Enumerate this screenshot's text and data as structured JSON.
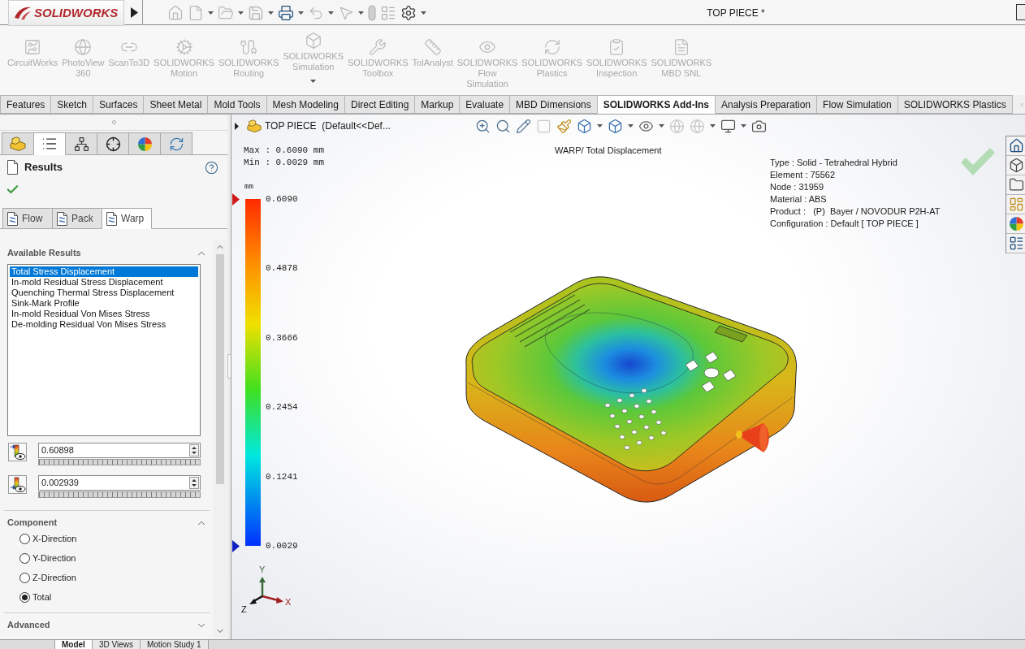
{
  "title_bar": {
    "brand": "SOLIDWORKS",
    "document_title": "TOP PIECE *"
  },
  "command_manager": {
    "items": [
      {
        "label_lines": [
          "CircuitWorks"
        ],
        "dropdown": false
      },
      {
        "label_lines": [
          "PhotoView",
          "360"
        ],
        "dropdown": false
      },
      {
        "label_lines": [
          "ScanTo3D"
        ],
        "dropdown": false
      },
      {
        "label_lines": [
          "SOLIDWORKS",
          "Motion"
        ],
        "dropdown": false
      },
      {
        "label_lines": [
          "SOLIDWORKS",
          "Routing"
        ],
        "dropdown": false
      },
      {
        "label_lines": [
          "SOLIDWORKS",
          "Simulation"
        ],
        "dropdown": true
      },
      {
        "label_lines": [
          "SOLIDWORKS",
          "Toolbox"
        ],
        "dropdown": false
      },
      {
        "label_lines": [
          "TolAnalyst"
        ],
        "dropdown": false
      },
      {
        "label_lines": [
          "SOLIDWORKS",
          "Flow",
          "Simulation"
        ],
        "dropdown": false
      },
      {
        "label_lines": [
          "SOLIDWORKS",
          "Plastics"
        ],
        "dropdown": false
      },
      {
        "label_lines": [
          "SOLIDWORKS",
          "Inspection"
        ],
        "dropdown": false
      },
      {
        "label_lines": [
          "SOLIDWORKS",
          "MBD SNL"
        ],
        "dropdown": false
      }
    ]
  },
  "tabs": [
    {
      "label": "Features",
      "selected": false
    },
    {
      "label": "Sketch",
      "selected": false
    },
    {
      "label": "Surfaces",
      "selected": false
    },
    {
      "label": "Sheet Metal",
      "selected": false
    },
    {
      "label": "Mold Tools",
      "selected": false
    },
    {
      "label": "Mesh Modeling",
      "selected": false
    },
    {
      "label": "Direct Editing",
      "selected": false
    },
    {
      "label": "Markup",
      "selected": false
    },
    {
      "label": "Evaluate",
      "selected": false
    },
    {
      "label": "MBD Dimensions",
      "selected": false
    },
    {
      "label": "SOLIDWORKS Add-Ins",
      "selected": true
    },
    {
      "label": "Analysis Preparation",
      "selected": false
    },
    {
      "label": "Flow Simulation",
      "selected": false
    },
    {
      "label": "SOLIDWORKS Plastics",
      "selected": false
    }
  ],
  "property_manager": {
    "icon_tabs": [
      {
        "kind": "part",
        "selected": false
      },
      {
        "kind": "properties",
        "selected": true
      },
      {
        "kind": "configurations",
        "selected": false
      },
      {
        "kind": "dimxpert",
        "selected": false
      },
      {
        "kind": "appearance",
        "selected": false
      },
      {
        "kind": "plastics",
        "selected": false
      }
    ],
    "title": "Results",
    "result_tabs": [
      {
        "label": "Flow",
        "selected": false
      },
      {
        "label": "Pack",
        "selected": false
      },
      {
        "label": "Warp",
        "selected": true
      }
    ],
    "available_results": {
      "heading": "Available Results",
      "expanded": true,
      "items": [
        {
          "label": "Total Stress Displacement",
          "selected": true
        },
        {
          "label": "In-mold Residual Stress Displacement",
          "selected": false
        },
        {
          "label": "Quenching Thermal Stress Displacement",
          "selected": false
        },
        {
          "label": "Sink-Mark Profile",
          "selected": false
        },
        {
          "label": "In-mold Residual Von Mises Stress",
          "selected": false
        },
        {
          "label": "De-molding Residual Von Mises Stress",
          "selected": false
        }
      ]
    },
    "max_value": "0.60898",
    "min_value": "0.002939",
    "component": {
      "heading": "Component",
      "expanded": true,
      "options": [
        {
          "label": "X-Direction",
          "selected": false
        },
        {
          "label": "Y-Direction",
          "selected": false
        },
        {
          "label": "Z-Direction",
          "selected": false
        },
        {
          "label": "Total",
          "selected": true
        }
      ]
    },
    "advanced": {
      "heading": "Advanced",
      "expanded": false
    }
  },
  "viewport": {
    "breadcrumb": "TOP PIECE  (Default<<Def...",
    "max_line": "Max : 0.6090 mm",
    "min_line": "Min : 0.0029 mm",
    "plot_title": "WARP/ Total Displacement",
    "legend": {
      "unit": "mm",
      "labels": [
        "0.6090",
        "0.4878",
        "0.3666",
        "0.2454",
        "0.1241",
        "0.0029"
      ]
    },
    "info": [
      "Type : Solid - Tetrahedral Hybrid",
      "Element : 75562",
      "Node : 31959",
      "Material : ABS",
      "Product :   (P)  Bayer / NOVODUR P2H-AT",
      "Configuration : Default [ TOP PIECE ]"
    ],
    "triad": {
      "x": "X",
      "y": "Y",
      "z": "Z"
    }
  },
  "bottom_tabs": [
    {
      "label": "Model",
      "selected": true
    },
    {
      "label": "3D Views",
      "selected": false
    },
    {
      "label": "Motion Study 1",
      "selected": false
    }
  ]
}
